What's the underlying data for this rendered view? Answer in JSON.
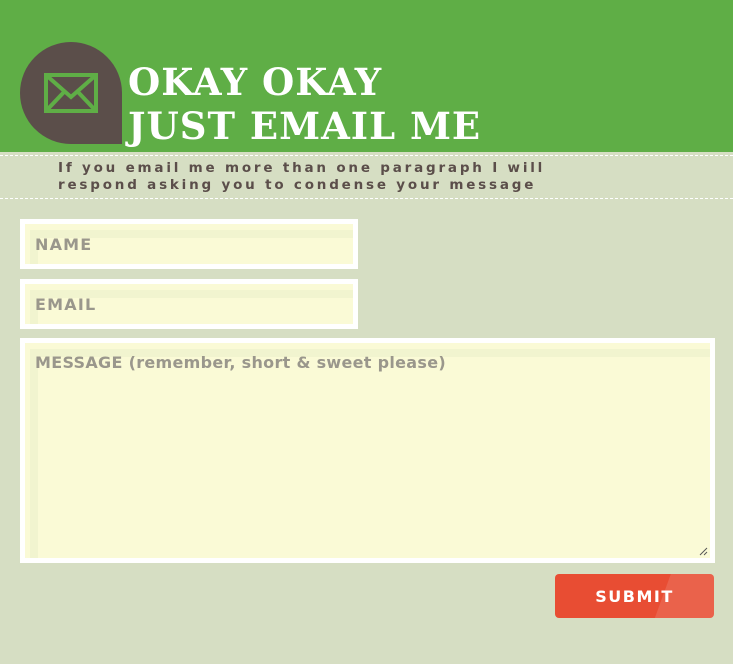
{
  "header": {
    "title_line1": "OKAY OKAY",
    "title_line2": "JUST EMAIL ME",
    "icon": "envelope-icon"
  },
  "intro": {
    "line1": "If you email me more than one paragraph I will",
    "line2": "respond asking you to condense your message"
  },
  "form": {
    "name_placeholder": "NAME",
    "email_placeholder": "EMAIL",
    "message_placeholder": "MESSAGE (remember, short & sweet please)",
    "submit_label": "SUBMIT"
  },
  "colors": {
    "header_bg": "#5fae46",
    "page_bg": "#d6dec3",
    "badge_bg": "#5b4e4a",
    "field_bg": "#fafad6",
    "submit_bg": "#e84d33"
  }
}
